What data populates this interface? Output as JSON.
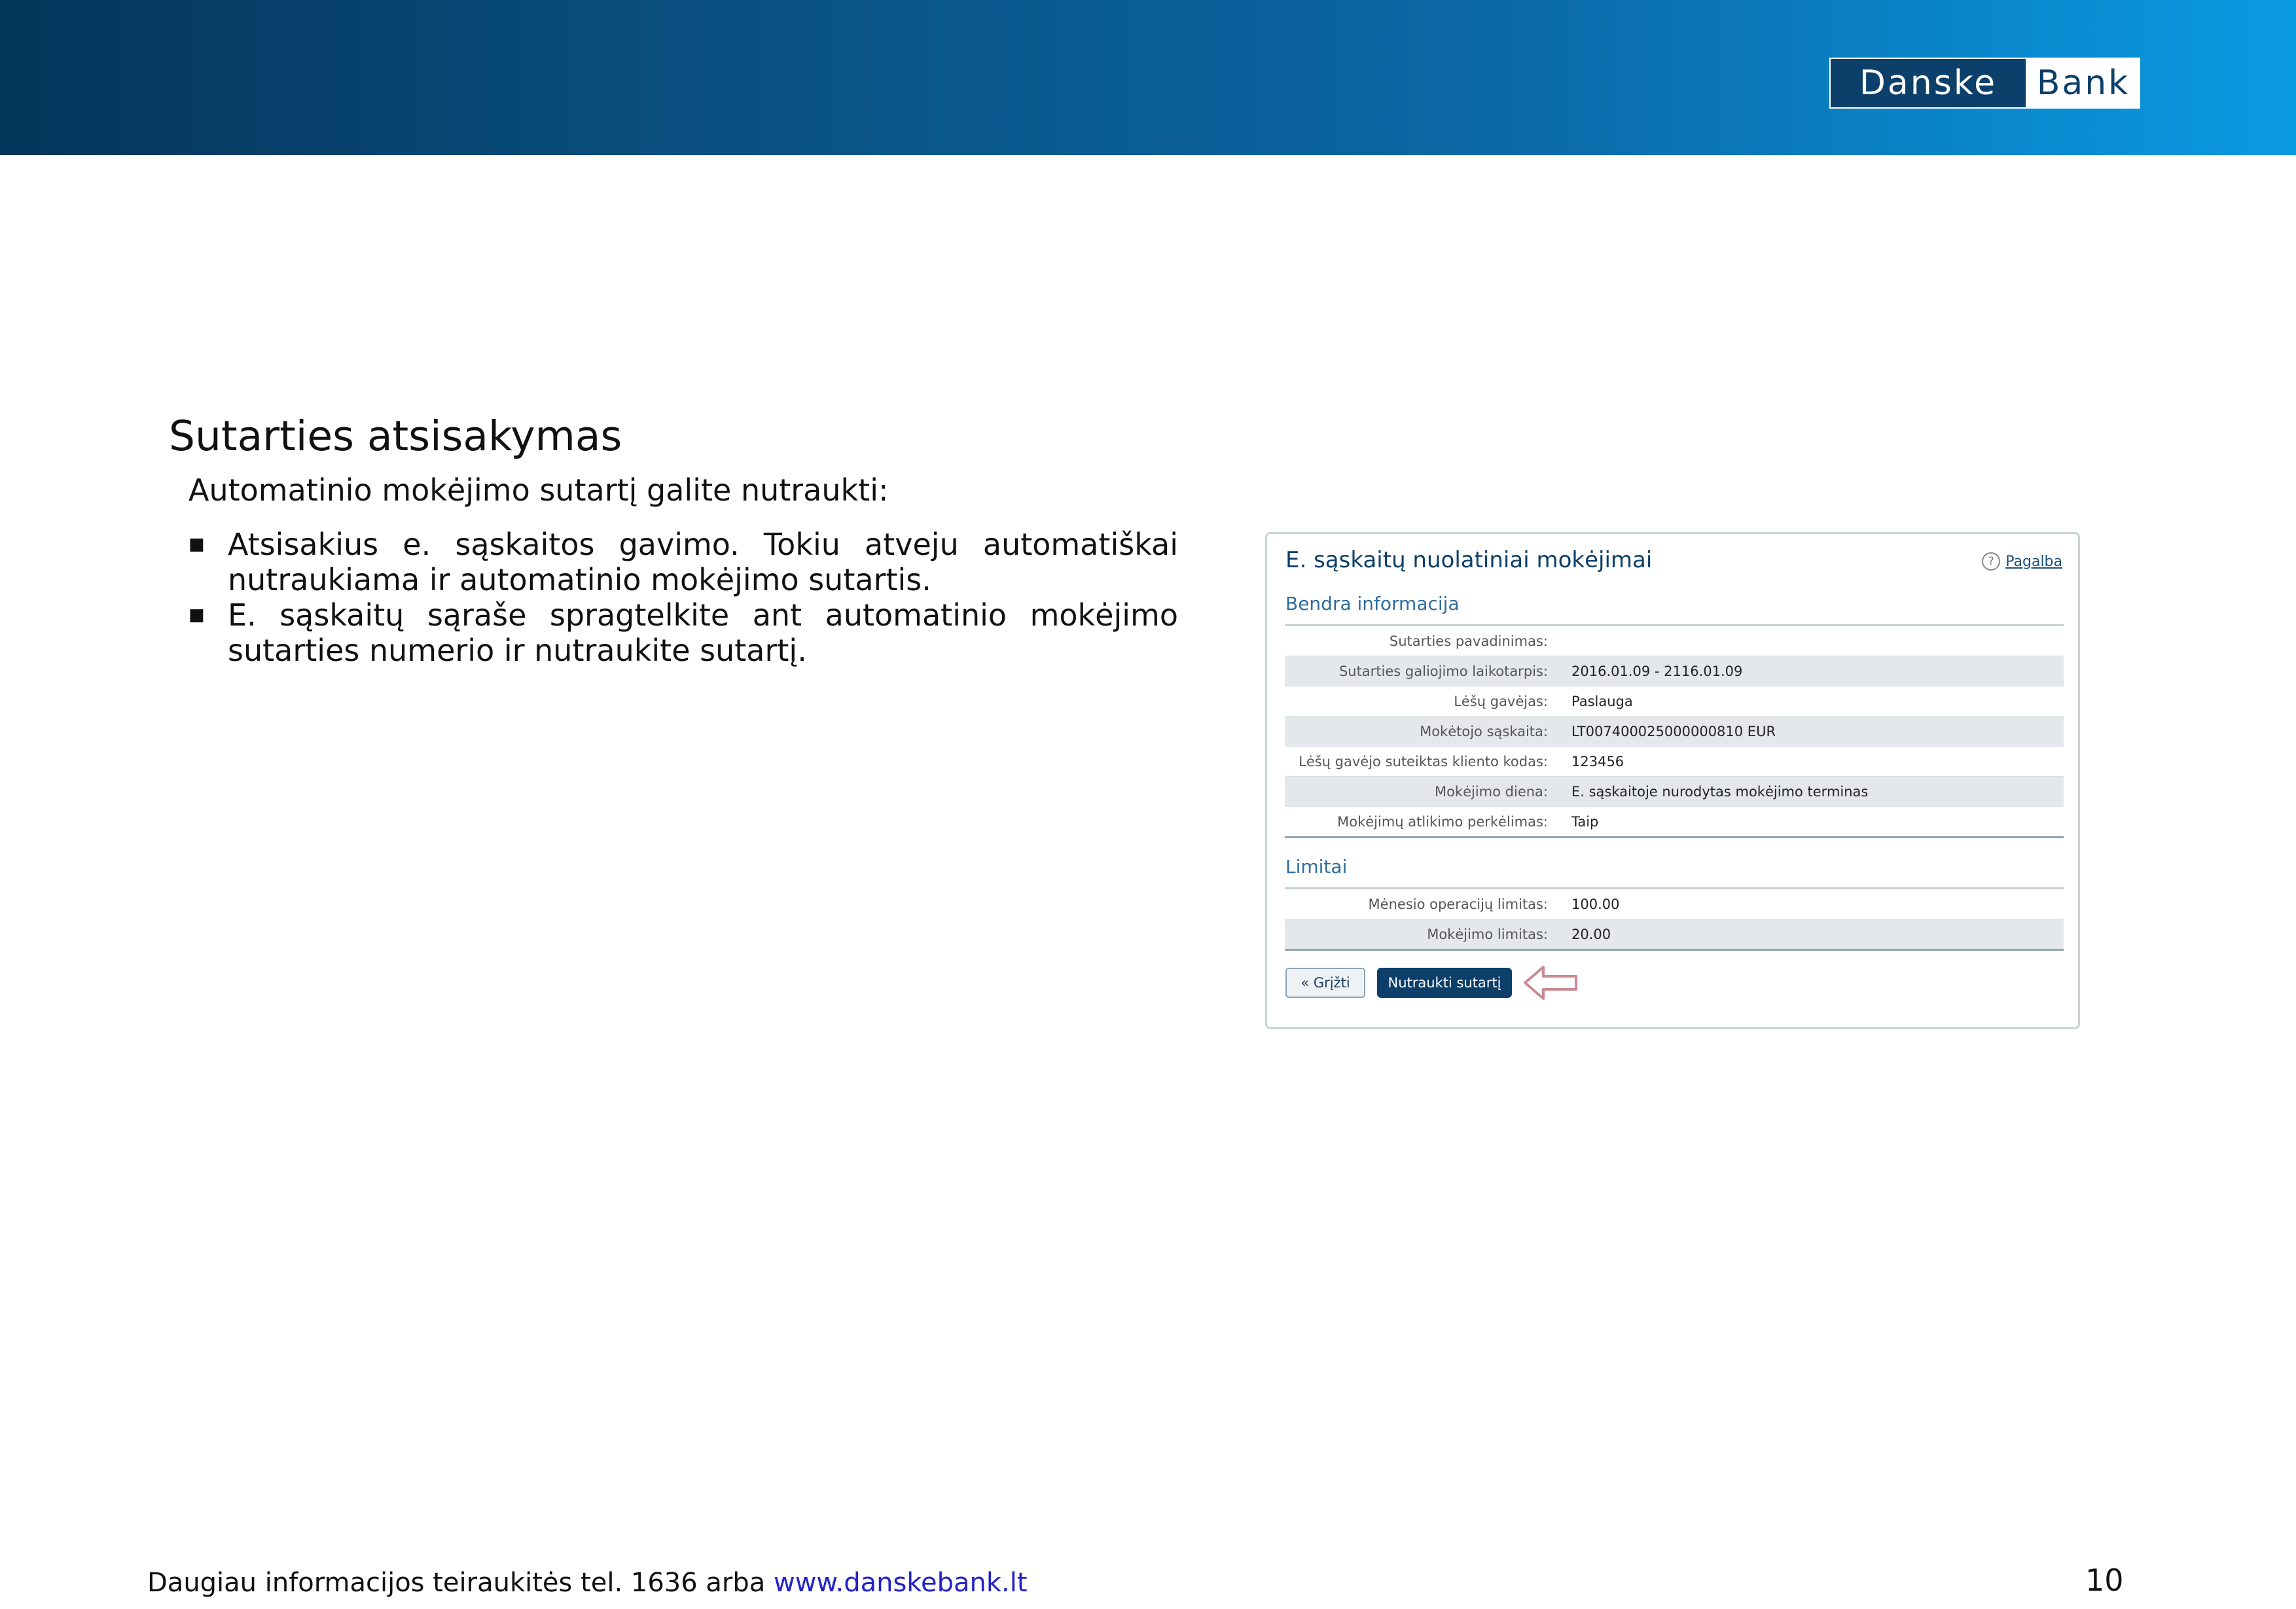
{
  "logo": {
    "left": "Danske",
    "right": "Bank"
  },
  "title": "Sutarties atsisakymas",
  "intro": "Automatinio mokėjimo sutartį galite nutraukti:",
  "bullets": [
    {
      "marker": "■",
      "text": "Atsisakius e. sąskaitos gavimo. Tokiu atveju automatiškai nutraukiama ir automatinio mokėjimo sutartis."
    },
    {
      "marker": "■",
      "text": "E. sąskaitų sąraše spragtelkite ant automatinio mokėjimo sutarties numerio ir nutraukite sutartį."
    }
  ],
  "panel": {
    "title": "E. sąskaitų nuolatiniai mokėjimai",
    "help_icon": "?",
    "help_label": "Pagalba",
    "general_section": "Bendra informacija",
    "general_rows": [
      {
        "label": "Sutarties pavadinimas:",
        "value": ""
      },
      {
        "label": "Sutarties galiojimo laikotarpis:",
        "value": "2016.01.09 - 2116.01.09"
      },
      {
        "label": "Lėšų gavėjas:",
        "value": "Paslauga"
      },
      {
        "label": "Mokėtojo sąskaita:",
        "value": "LT007400025000000810   EUR"
      },
      {
        "label": "Lėšų gavėjo suteiktas kliento kodas:",
        "value": "123456"
      },
      {
        "label": "Mokėjimo diena:",
        "value": "E. sąskaitoje nurodytas mokėjimo terminas"
      },
      {
        "label": "Mokėjimų atlikimo perkėlimas:",
        "value": "Taip"
      }
    ],
    "limits_section": "Limitai",
    "limits_rows": [
      {
        "label": "Mėnesio operacijų limitas:",
        "value": "100.00"
      },
      {
        "label": "Mokėjimo limitas:",
        "value": "20.00"
      }
    ],
    "back_button": "« Grįžti",
    "terminate_button": "Nutraukti sutartį"
  },
  "footer": {
    "text": "Daugiau informacijos teiraukitės tel. 1636 arba ",
    "link": "www.danskebank.lt"
  },
  "page_number": "10"
}
